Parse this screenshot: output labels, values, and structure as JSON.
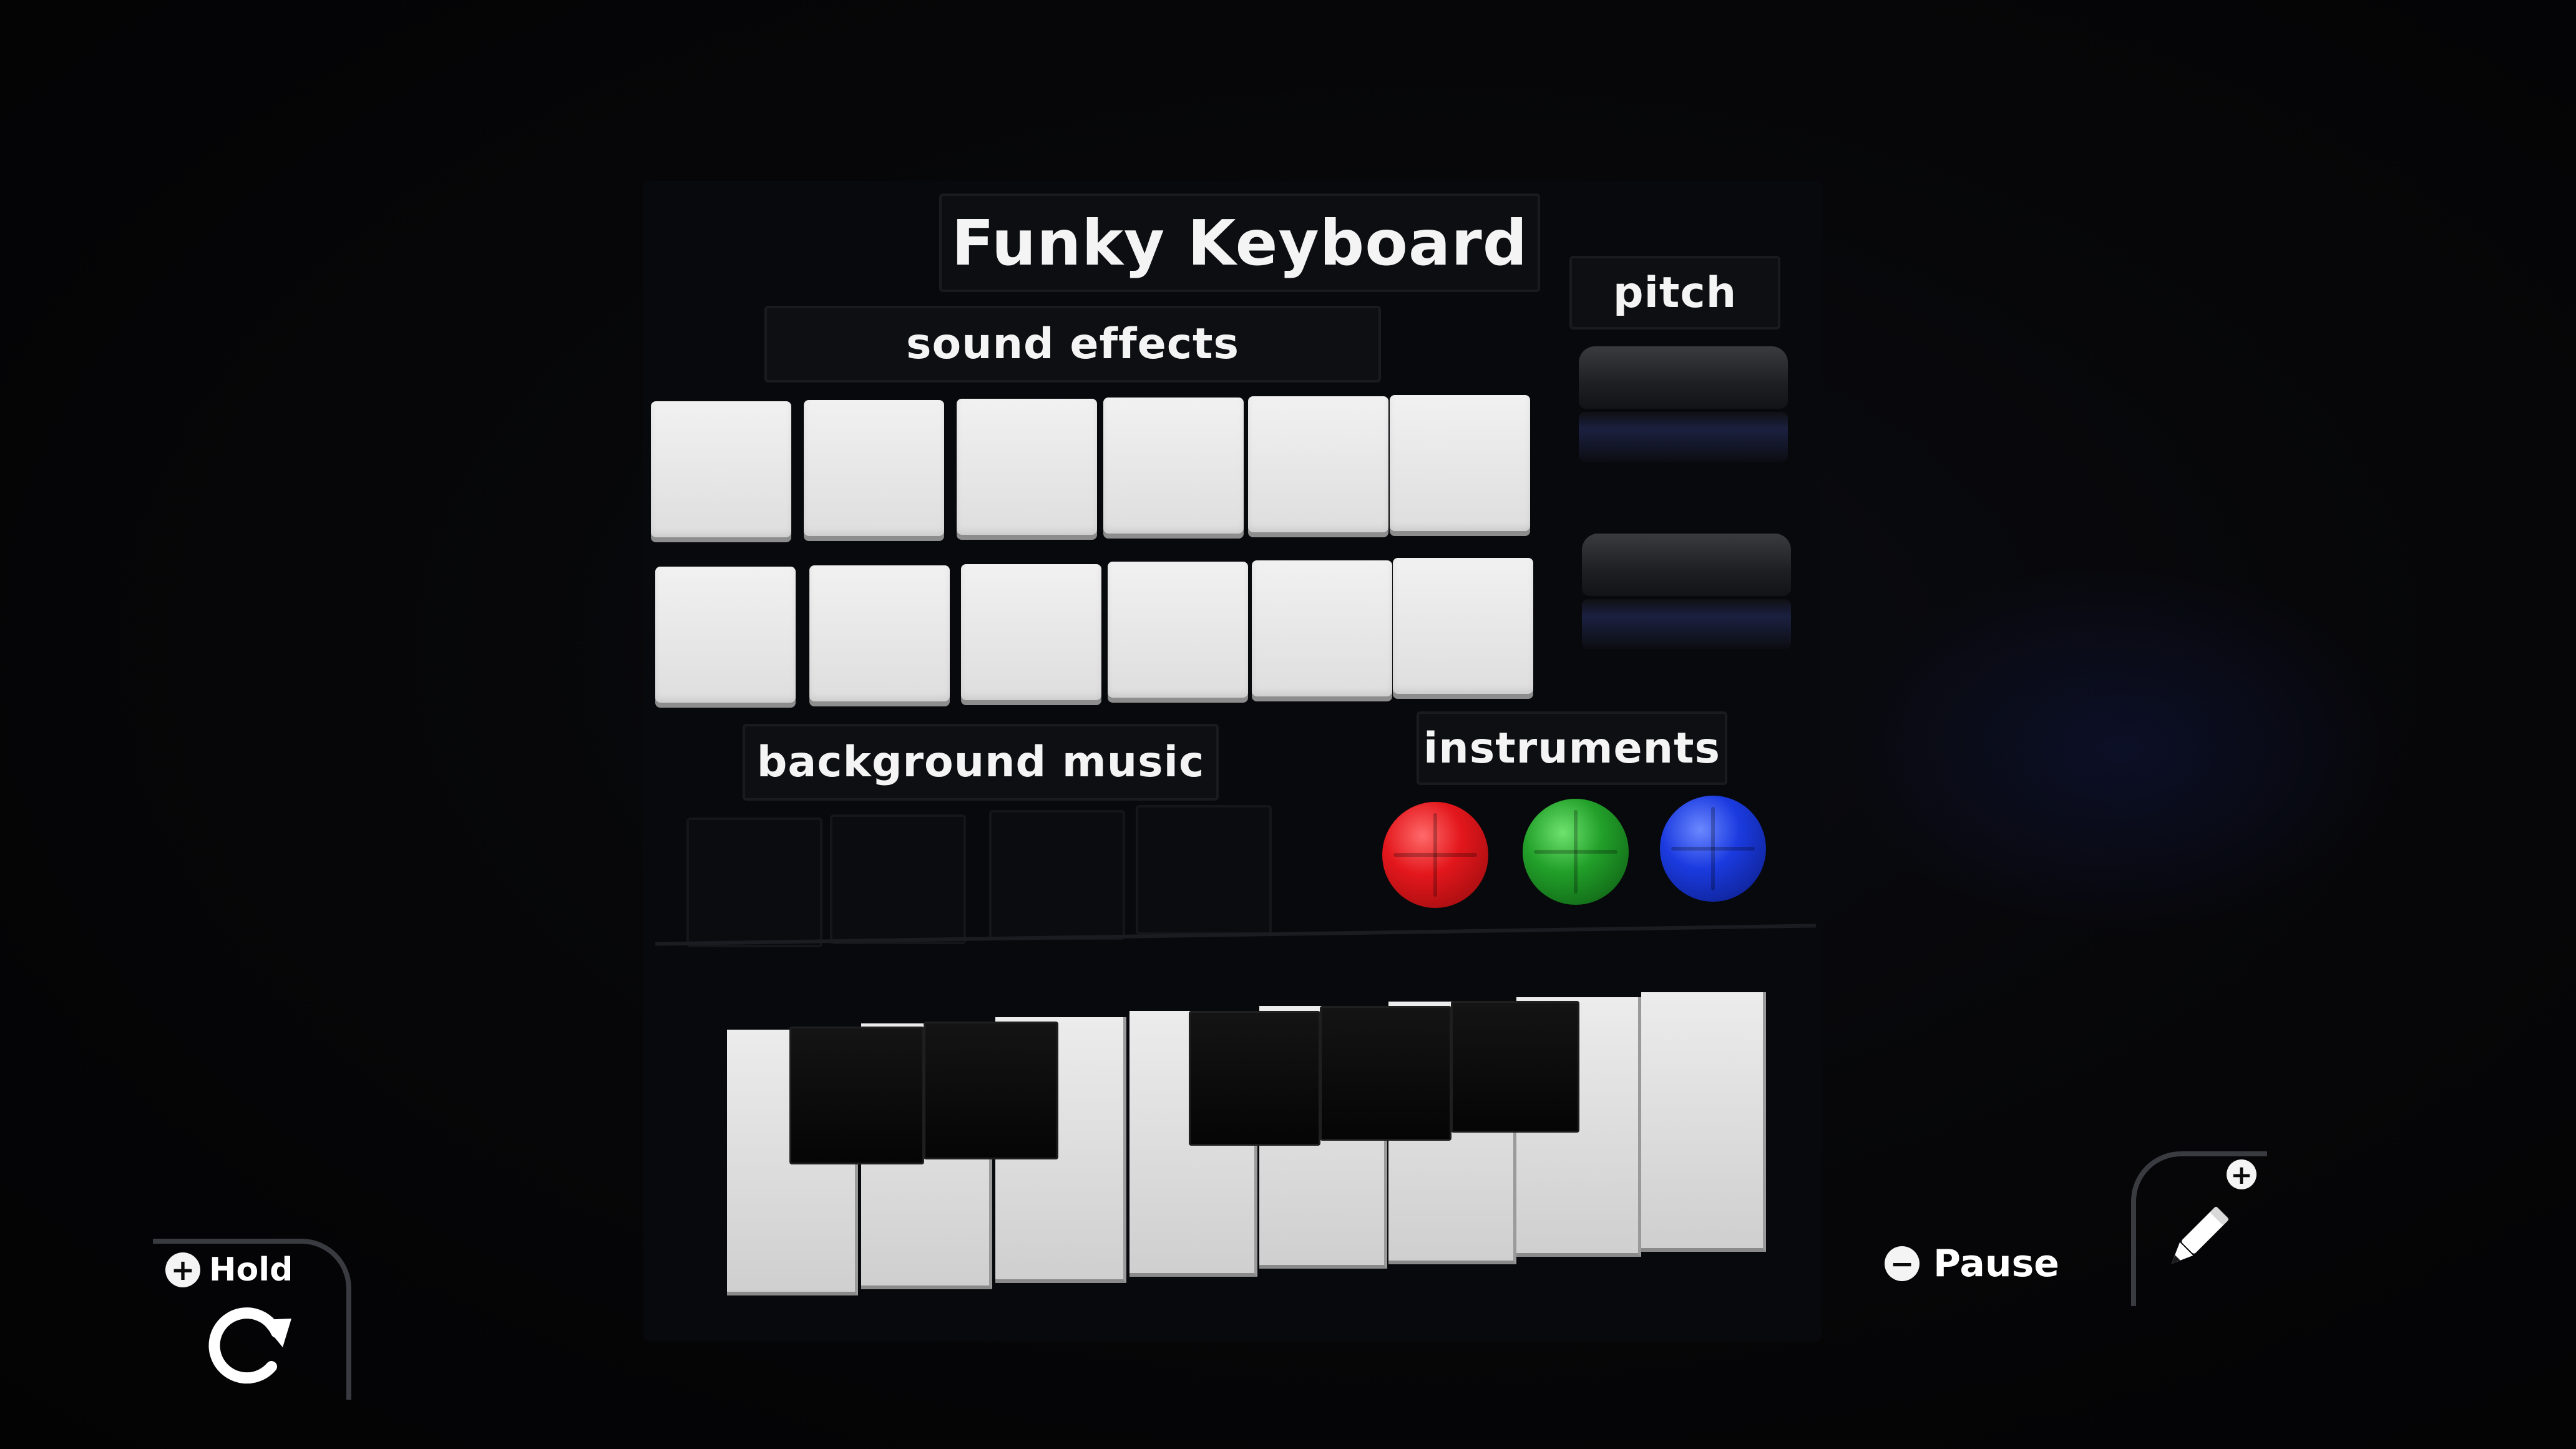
{
  "app": {
    "title": "Funky Keyboard"
  },
  "sections": {
    "sound_effects": "sound effects",
    "pitch": "pitch",
    "background_music": "background music",
    "instruments": "instruments"
  },
  "sound_effect_pads": {
    "rows": 2,
    "per_row": 6
  },
  "background_music_pads": {
    "count": 4
  },
  "pitch_sliders": {
    "count": 2
  },
  "instruments": [
    {
      "name": "red",
      "color": "#e3171c"
    },
    {
      "name": "green",
      "color": "#22a02a"
    },
    {
      "name": "blue",
      "color": "#1b3be0"
    }
  ],
  "keyboard": {
    "white_keys": 8,
    "black_keys": 5
  },
  "hud": {
    "hold_button": "+",
    "hold_label": "Hold",
    "pause_button": "−",
    "pause_label": "Pause",
    "edit_plus": "+"
  },
  "icons": {
    "reset": "rotate-icon",
    "edit": "pencil-icon"
  }
}
